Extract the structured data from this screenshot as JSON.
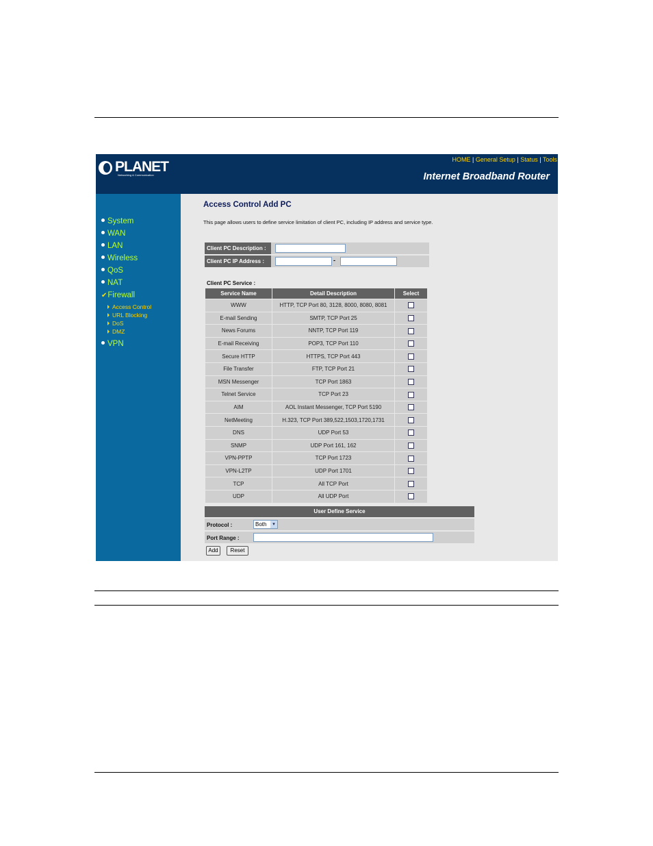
{
  "header": {
    "logo_text": "PLANET",
    "logo_subtext": "Networking & Communication",
    "top_links": [
      "HOME",
      "General Setup",
      "Status",
      "Tools"
    ],
    "separator": "|",
    "product_name": "Internet Broadband Router"
  },
  "sidebar": {
    "items": [
      {
        "label": "System"
      },
      {
        "label": "WAN"
      },
      {
        "label": "LAN"
      },
      {
        "label": "Wireless"
      },
      {
        "label": "QoS"
      },
      {
        "label": "NAT"
      },
      {
        "label": "Firewall"
      },
      {
        "label": "VPN"
      }
    ],
    "firewall_subitems": [
      "Access Control",
      "URL Blocking",
      "DoS",
      "DMZ"
    ]
  },
  "main": {
    "title": "Access Control Add PC",
    "description": "This page allows users to define service limitation of client PC, including IP address and service type.",
    "client_pc_description_label": "Client PC Description :",
    "client_pc_description_value": "",
    "client_pc_ip_label": "Client PC IP Address :",
    "ip_start_value": "",
    "ip_dash": "-",
    "ip_end_value": "",
    "service_caption": "Client PC Service :",
    "service_headers": [
      "Service Name",
      "Detail Description",
      "Select"
    ],
    "services": [
      {
        "name": "WWW",
        "detail": "HTTP, TCP Port 80, 3128, 8000, 8080, 8081"
      },
      {
        "name": "E-mail Sending",
        "detail": "SMTP, TCP Port 25"
      },
      {
        "name": "News Forums",
        "detail": "NNTP, TCP Port 119"
      },
      {
        "name": "E-mail Receiving",
        "detail": "POP3, TCP Port 110"
      },
      {
        "name": "Secure HTTP",
        "detail": "HTTPS, TCP Port 443"
      },
      {
        "name": "File Transfer",
        "detail": "FTP, TCP Port 21"
      },
      {
        "name": "MSN Messenger",
        "detail": "TCP Port 1863"
      },
      {
        "name": "Telnet Service",
        "detail": "TCP Port 23"
      },
      {
        "name": "AIM",
        "detail": "AOL Instant Messenger, TCP Port 5190"
      },
      {
        "name": "NetMeeting",
        "detail": "H.323, TCP Port 389,522,1503,1720,1731"
      },
      {
        "name": "DNS",
        "detail": "UDP Port 53"
      },
      {
        "name": "SNMP",
        "detail": "UDP Port 161, 162"
      },
      {
        "name": "VPN-PPTP",
        "detail": "TCP Port 1723"
      },
      {
        "name": "VPN-L2TP",
        "detail": "UDP Port 1701"
      },
      {
        "name": "TCP",
        "detail": "All TCP Port"
      },
      {
        "name": "UDP",
        "detail": "All UDP Port"
      }
    ],
    "user_define_header": "User Define Service",
    "protocol_label": "Protocol :",
    "protocol_value": "Both",
    "port_range_label": "Port Range :",
    "port_range_value": "",
    "add_button": "Add",
    "reset_button": "Reset"
  }
}
